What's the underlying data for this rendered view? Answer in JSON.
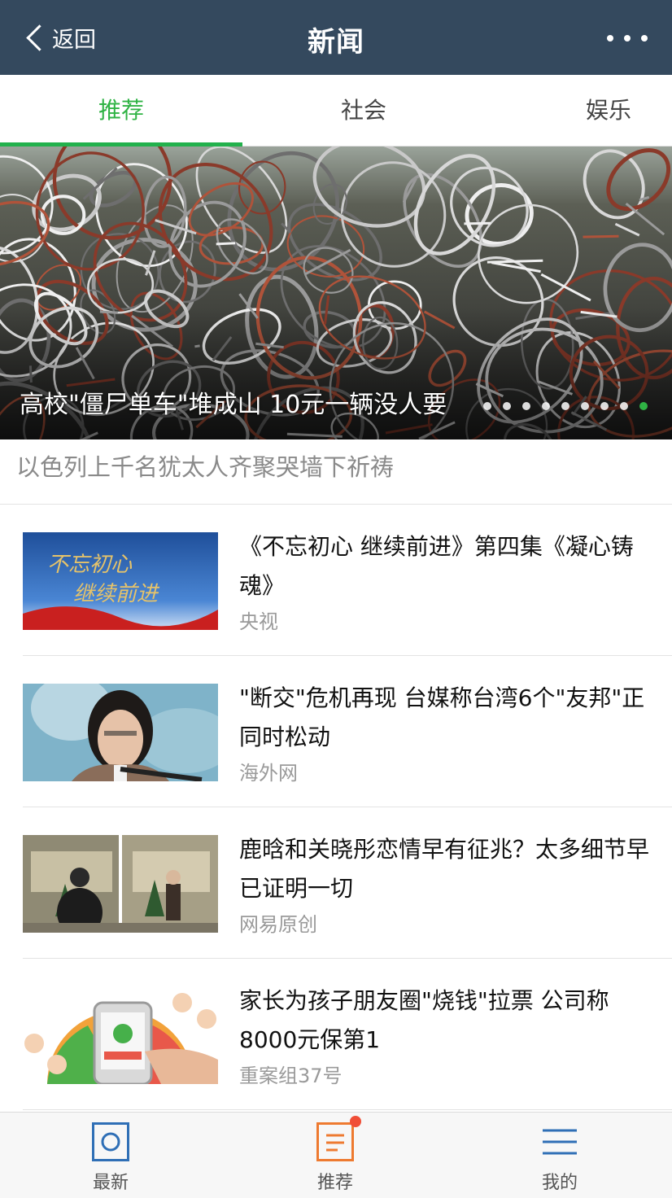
{
  "header": {
    "back_label": "返回",
    "title": "新闻"
  },
  "tabs": [
    {
      "label": "推荐",
      "active": true
    },
    {
      "label": "社会",
      "active": false
    },
    {
      "label": "娱乐",
      "active": false
    }
  ],
  "carousel": {
    "caption": "高校\"僵尸单车\"堆成山 10元一辆没人要",
    "slide_count": 9,
    "active_index": 8
  },
  "subheadline": "以色列上千名犹太人齐聚哭墙下祈祷",
  "news": [
    {
      "title": "《不忘初心 继续前进》第四集《凝心铸魂》",
      "source": "央视",
      "thumb_text": "不忘初心 继续前进"
    },
    {
      "title": "\"断交\"危机再现 台媒称台湾6个\"友邦\"正同时松动",
      "source": "海外网"
    },
    {
      "title": "鹿晗和关晓彤恋情早有征兆？太多细节早已证明一切",
      "source": "网易原创"
    },
    {
      "title": "家长为孩子朋友圈\"烧钱\"拉票 公司称8000元保第1",
      "source": "重案组37号"
    }
  ],
  "bottom_nav": [
    {
      "label": "最新",
      "color": "#2f6fb6"
    },
    {
      "label": "推荐",
      "color": "#ee7a30",
      "badge": true
    },
    {
      "label": "我的",
      "color": "#2f6fb6"
    }
  ],
  "colors": {
    "header_bg": "#34495e",
    "accent_green": "#2fb344",
    "badge_red": "#f04e37"
  }
}
